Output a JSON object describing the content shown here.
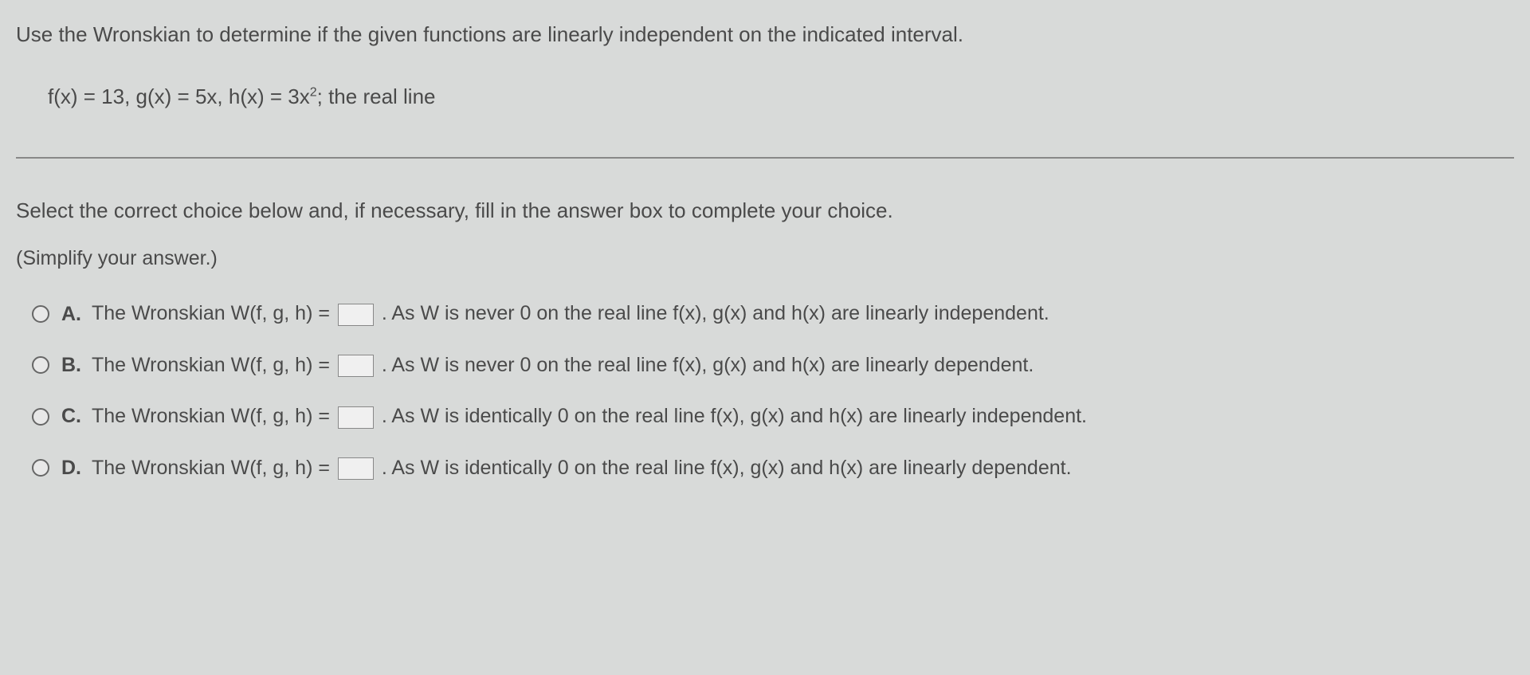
{
  "question": {
    "intro": "Use the Wronskian to determine if the given functions are linearly independent on the indicated interval.",
    "problem_prefix": "f(x) = 13, g(x) = 5x, h(x) = 3x",
    "problem_exp": "2",
    "problem_suffix": "; the real line",
    "instructions": "Select the correct choice below and, if necessary, fill in the answer box to complete your choice.",
    "simplify": "(Simplify your answer.)"
  },
  "choices": {
    "a": {
      "label": "A.",
      "text_before": "The Wronskian W(f, g, h) = ",
      "text_after": ". As W is never 0 on the real line f(x), g(x) and h(x) are linearly independent."
    },
    "b": {
      "label": "B.",
      "text_before": "The Wronskian W(f, g, h) = ",
      "text_after": ". As W is never 0 on the real line f(x), g(x) and h(x) are linearly dependent."
    },
    "c": {
      "label": "C.",
      "text_before": "The Wronskian W(f, g, h) = ",
      "text_after": ". As W is identically 0 on the real line f(x), g(x) and h(x) are linearly independent."
    },
    "d": {
      "label": "D.",
      "text_before": "The Wronskian W(f, g, h) = ",
      "text_after": ". As W is identically 0 on the real line f(x), g(x) and h(x) are linearly dependent."
    }
  }
}
